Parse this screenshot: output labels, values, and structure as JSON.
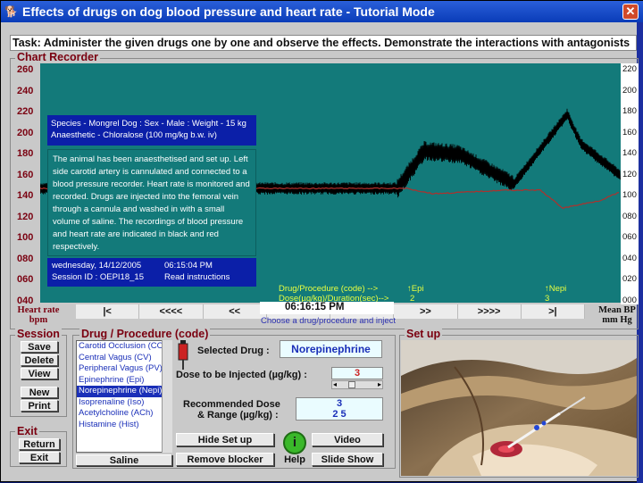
{
  "window": {
    "title": "Effects of drugs on dog blood pressure and heart rate - Tutorial Mode",
    "close_glyph": "✕",
    "app_glyph": "🐕"
  },
  "task": "Task: Administer the given drugs one by one and observe the effects. Demonstrate the interactions with antagonists",
  "chart": {
    "group_label": "Chart Recorder",
    "left_ticks": [
      "260",
      "240",
      "220",
      "200",
      "180",
      "160",
      "140",
      "120",
      "100",
      "080",
      "060",
      "040"
    ],
    "right_ticks": [
      "220",
      "200",
      "180",
      "160",
      "140",
      "120",
      "100",
      "080",
      "060",
      "040",
      "020",
      "000"
    ],
    "left_unit": "Heart rate bpm",
    "right_unit": "Mean BP mm Hg",
    "trace_colors": {
      "bp": "#000000",
      "hr": "#b0302c"
    }
  },
  "info": {
    "species": "Species - Mongrel Dog : Sex - Male : Weight - 15 kg",
    "anaesthetic": "Anaesthetic - Chloralose (100 mg/kg b.w. iv)",
    "description": "The animal has been anaesthetised and set up. Left side carotid artery is cannulated and connected to a blood pressure recorder. Heart rate is monitored and recorded. Drugs are injected into the femoral vein through a cannula and washed in with a small volume of saline. The recordings of blood pressure and heart rate are indicated in black and red respectively.",
    "date": "wednesday, 14/12/2005",
    "time": "06:15:04 PM",
    "session": "Session ID : OEPI18_15",
    "read_instructions": "Read instructions"
  },
  "procedure": {
    "label1": "Drug/Procedure (code) -->",
    "label2": "Dose(µg/kg)/Duration(sec)-->",
    "marker1_name": "↑Epi",
    "marker1_dose": "2",
    "marker2_name": "↑Nepi",
    "marker2_dose": "3"
  },
  "nav": {
    "buttons": [
      "|<",
      "<<<<",
      "<<",
      "<",
      ">",
      ">>",
      ">>>>",
      ">|"
    ],
    "clock": "06:16:15 PM",
    "choose_label": "Choose a drug/procedure and inject"
  },
  "session": {
    "group_label": "Session",
    "save": "Save",
    "delete": "Delete",
    "view": "View",
    "new": "New",
    "print": "Print"
  },
  "exit": {
    "group_label": "Exit",
    "return": "Return",
    "exit": "Exit"
  },
  "drug_panel": {
    "group_label": "Drug / Procedure (code)",
    "list": [
      "Carotid Occlusion (CO)",
      "Central Vagus (CV)",
      "Peripheral Vagus (PV)",
      "Epinephrine (Epi)",
      "Norepinephrine (Nepi)",
      "Isoprenaline (Iso)",
      "Acetylcholine (ACh)",
      "Histamine (Hist)"
    ],
    "selected_index": 4,
    "selected_drug_label": "Selected Drug :",
    "selected_drug": "Norepinephrine",
    "dose_label": "Dose to be Injected (µg/kg) :",
    "dose_value": "3",
    "recommended_label1": "Recommended Dose",
    "recommended_label2": "& Range (µg/kg) :",
    "recommended_dose": "3",
    "recommended_range": "2  5",
    "saline": "Saline",
    "hide_setup": "Hide Set up",
    "remove_blocker": "Remove blocker",
    "help": "Help",
    "video": "Video",
    "slide_show": "Slide Show"
  },
  "setup": {
    "group_label": "Set up"
  }
}
